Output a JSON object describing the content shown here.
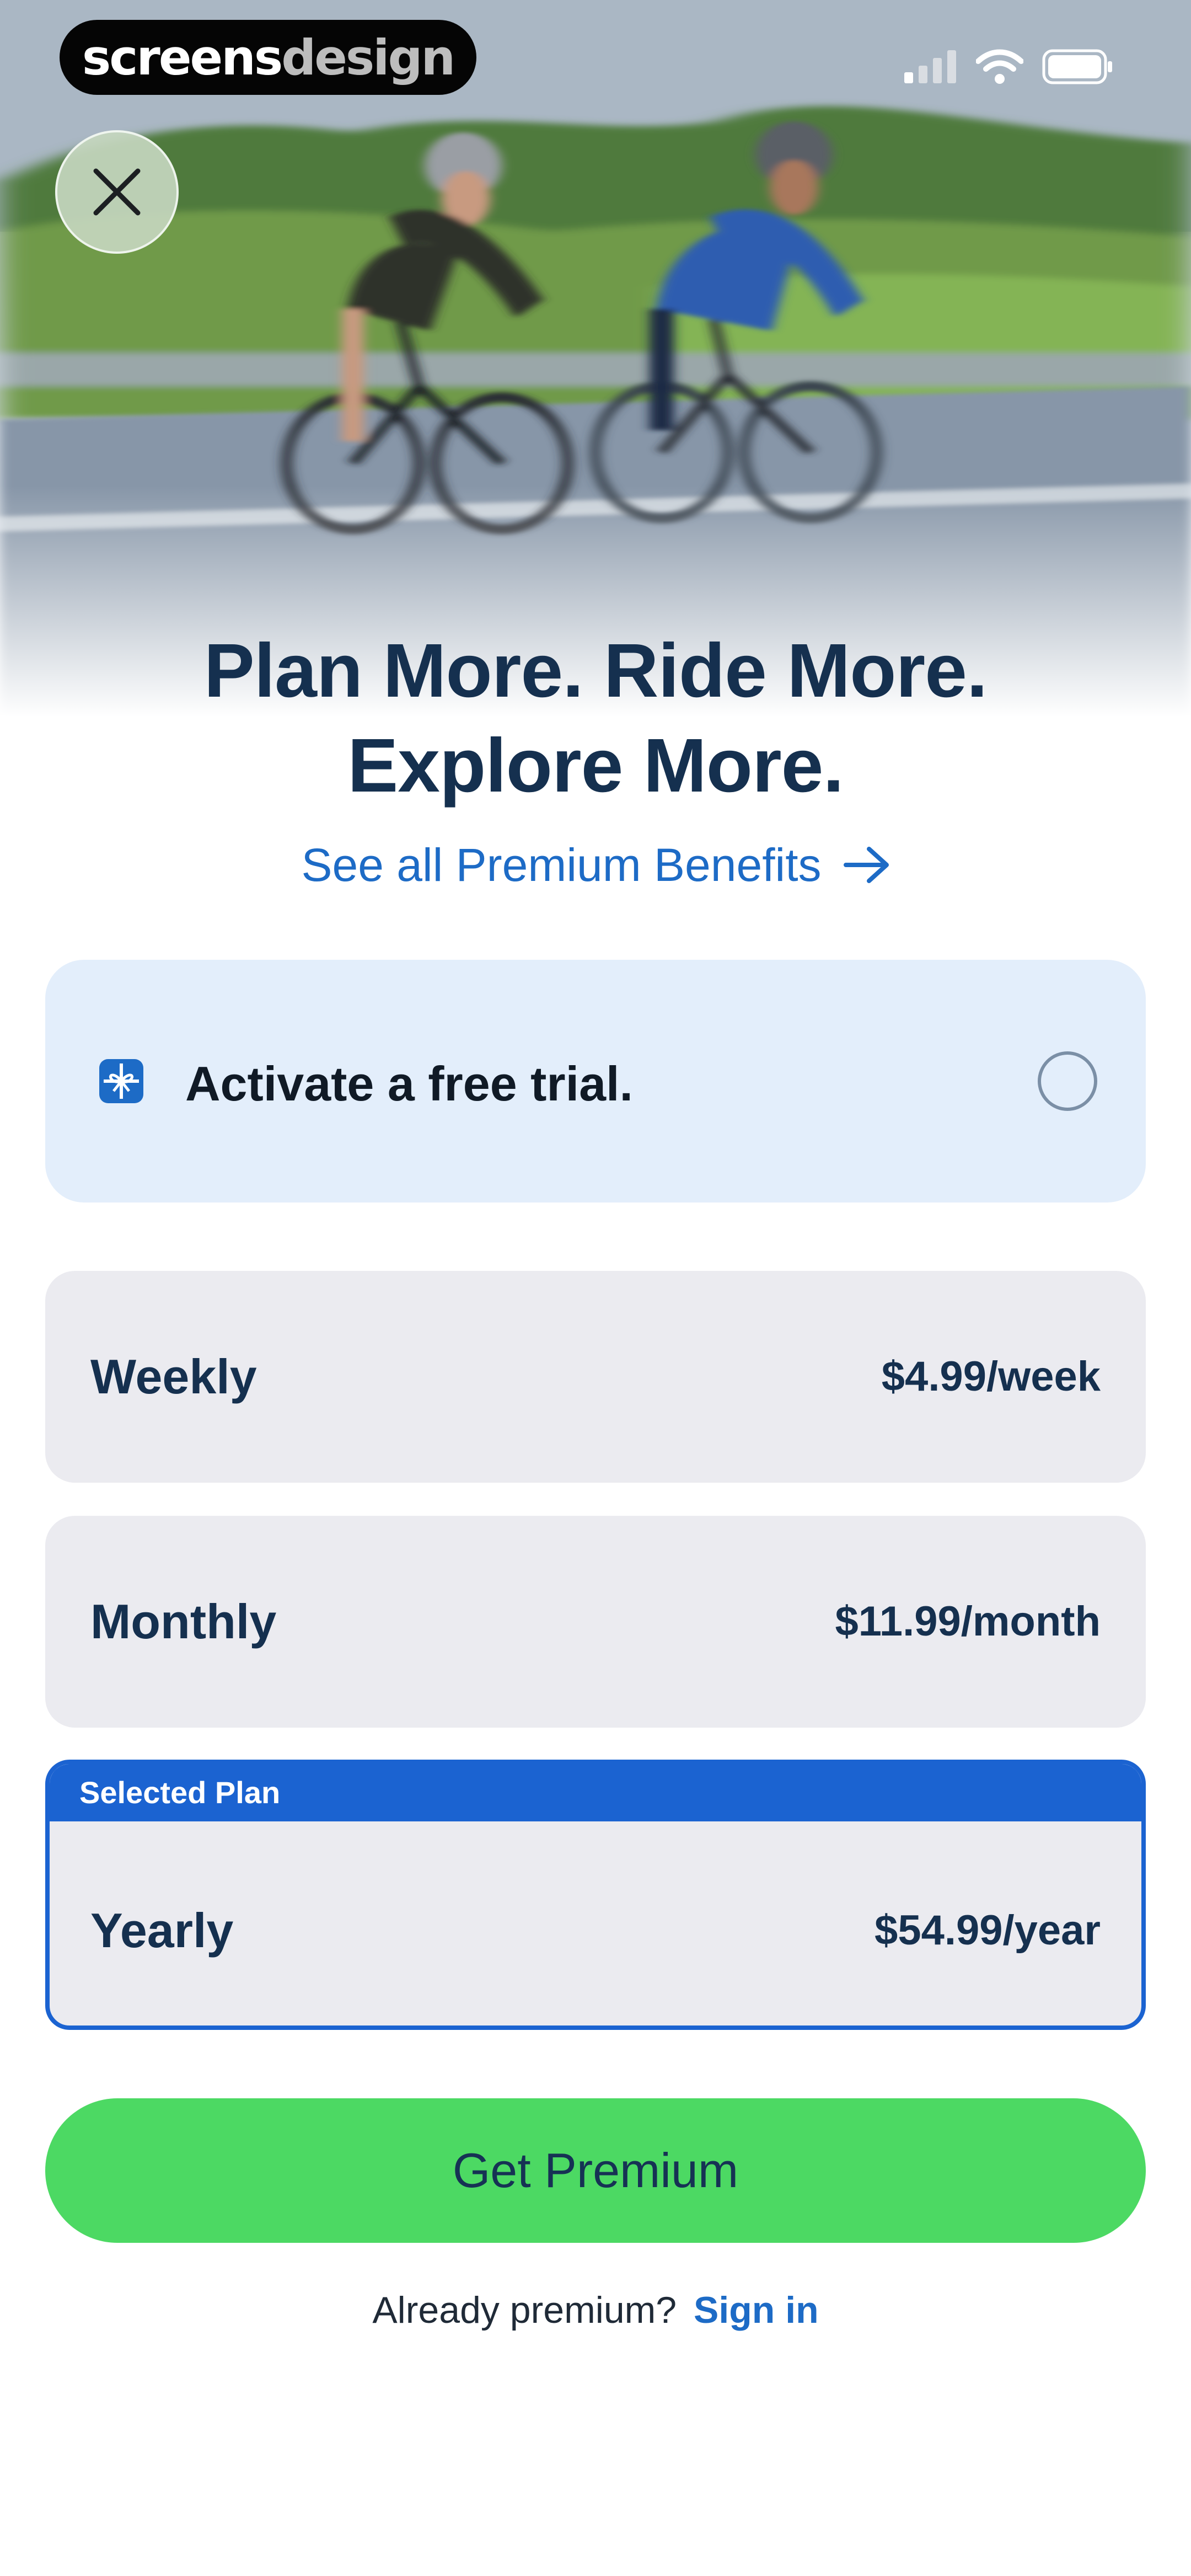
{
  "status_bar": {
    "brand_part1": "screens",
    "brand_part2": "design",
    "icons": [
      "cellular-signal-icon",
      "wifi-icon",
      "battery-icon"
    ]
  },
  "hero": {
    "image": "two road cyclists riding on a country road (motion blurred)",
    "close_icon": "close-icon"
  },
  "headline": {
    "line1": "Plan More. Ride More.",
    "line2": "Explore More."
  },
  "benefits_link": {
    "label": "See all Premium Benefits",
    "icon": "arrow-right-icon"
  },
  "trial": {
    "icon": "gift-icon",
    "label": "Activate a free trial.",
    "enabled": false
  },
  "plans": [
    {
      "name": "Weekly",
      "price": "$4.99/week",
      "selected": false
    },
    {
      "name": "Monthly",
      "price": "$11.99/month",
      "selected": false
    },
    {
      "name": "Yearly",
      "price": "$54.99/year",
      "selected": true,
      "badge": "Selected Plan"
    }
  ],
  "cta": {
    "label": "Get Premium"
  },
  "signin": {
    "prompt": "Already premium?",
    "link": "Sign in"
  },
  "colors": {
    "headline": "#15304f",
    "link": "#1d6bc6",
    "trial_bg": "#e3eefb",
    "plan_bg": "#ebebf0",
    "selected_border": "#1b63d1",
    "cta_bg": "#4cd963"
  }
}
